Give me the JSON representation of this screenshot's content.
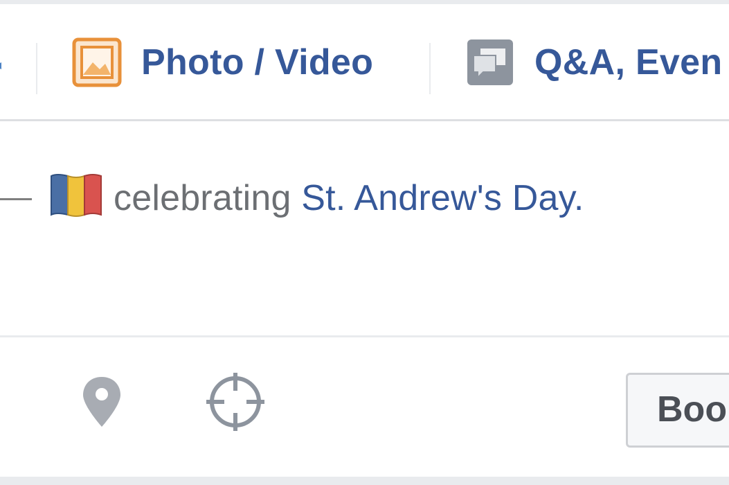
{
  "composer": {
    "tabs": [
      {
        "label": "Photo / Video",
        "icon": "photo-video-icon",
        "icon_color": "#e8913a"
      },
      {
        "label": "Q&A, Even",
        "icon": "speech-bubbles-icon",
        "icon_color": "#8d949e"
      }
    ]
  },
  "status": {
    "activity_icon": "romania-flag-icon",
    "verb": "celebrating",
    "event": "St. Andrew's Day."
  },
  "footer": {
    "location_icon": "map-pin-icon",
    "target_icon": "crosshair-icon",
    "boost_label": "Boo"
  },
  "colors": {
    "link_blue": "#365899",
    "muted_text": "#6c6f73",
    "border_gray": "#dddfe2",
    "flag_blue": "#4a6fa5",
    "flag_yellow": "#f0c33c",
    "flag_red": "#d9534f"
  }
}
